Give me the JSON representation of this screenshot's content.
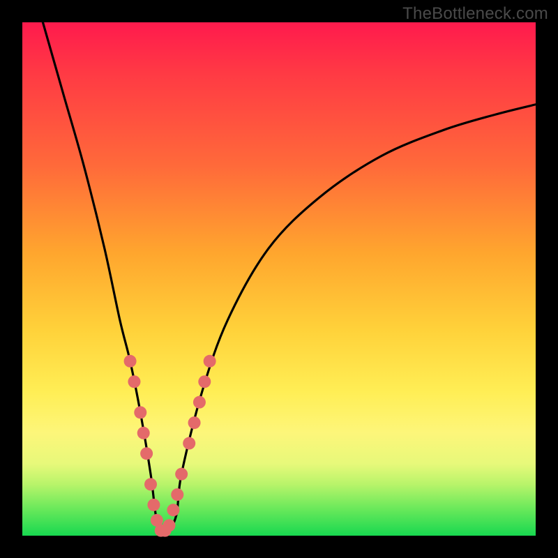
{
  "watermark": "TheBottleneck.com",
  "chart_data": {
    "type": "line",
    "title": "",
    "xlabel": "",
    "ylabel": "",
    "xlim": [
      0,
      100
    ],
    "ylim": [
      0,
      100
    ],
    "grid": false,
    "legend": false,
    "series": [
      {
        "name": "bottleneck-curve",
        "color": "#000000",
        "x": [
          4,
          8,
          12,
          16,
          19,
          21,
          23,
          25,
          26,
          27,
          28,
          30,
          31,
          35,
          40,
          48,
          58,
          70,
          82,
          92,
          100
        ],
        "y": [
          100,
          86,
          72,
          56,
          42,
          34,
          24,
          12,
          4,
          0,
          0,
          4,
          12,
          28,
          42,
          56,
          66,
          74,
          79,
          82,
          84
        ]
      }
    ],
    "markers": {
      "name": "highlight-points",
      "color": "#e46a6a",
      "radius_px": 9,
      "points": [
        {
          "x": 21.0,
          "y": 34
        },
        {
          "x": 21.8,
          "y": 30
        },
        {
          "x": 23.0,
          "y": 24
        },
        {
          "x": 23.6,
          "y": 20
        },
        {
          "x": 24.2,
          "y": 16
        },
        {
          "x": 25.0,
          "y": 10
        },
        {
          "x": 25.6,
          "y": 6
        },
        {
          "x": 26.2,
          "y": 3
        },
        {
          "x": 27.0,
          "y": 1
        },
        {
          "x": 27.8,
          "y": 1
        },
        {
          "x": 28.6,
          "y": 2
        },
        {
          "x": 29.4,
          "y": 5
        },
        {
          "x": 30.2,
          "y": 8
        },
        {
          "x": 31.0,
          "y": 12
        },
        {
          "x": 32.5,
          "y": 18
        },
        {
          "x": 33.5,
          "y": 22
        },
        {
          "x": 34.5,
          "y": 26
        },
        {
          "x": 35.5,
          "y": 30
        },
        {
          "x": 36.5,
          "y": 34
        }
      ]
    }
  }
}
